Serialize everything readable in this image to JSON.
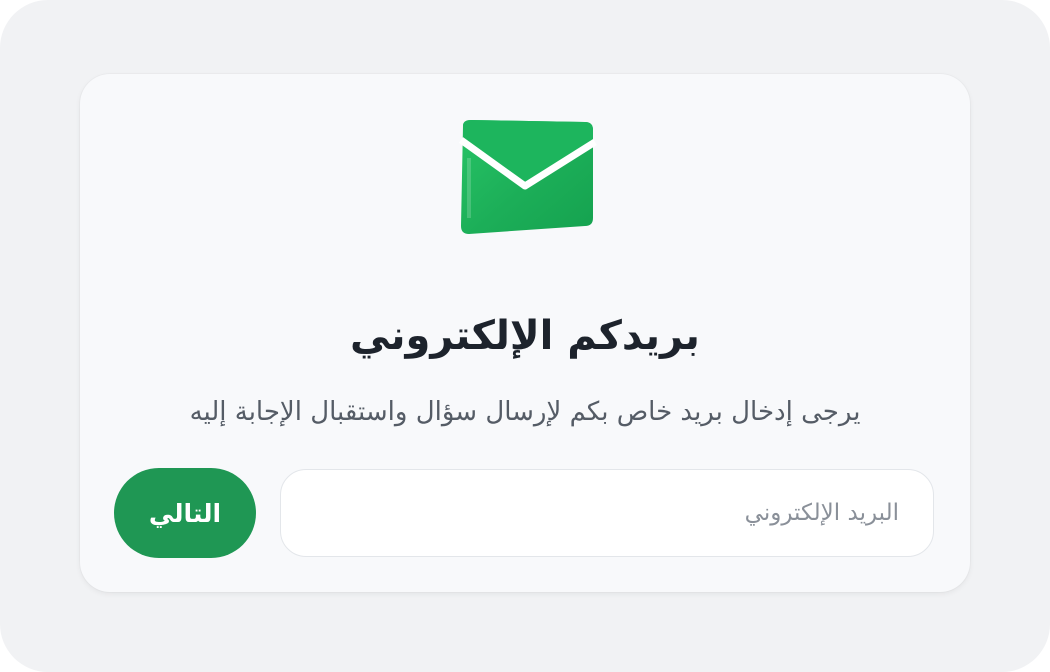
{
  "card": {
    "icon": "envelope-icon",
    "title": "بريدكم الإلكتروني",
    "subtitle": "يرجى إدخال بريد خاص بكم لإرسال سؤال واستقبال الإجابة إليه"
  },
  "form": {
    "email_placeholder": "البريد الإلكتروني",
    "email_value": "",
    "next_label": "التالي"
  },
  "colors": {
    "accent": "#1f9754",
    "icon_green": "#1fb35c",
    "background": "#f1f2f4",
    "card": "#f8f9fb"
  }
}
